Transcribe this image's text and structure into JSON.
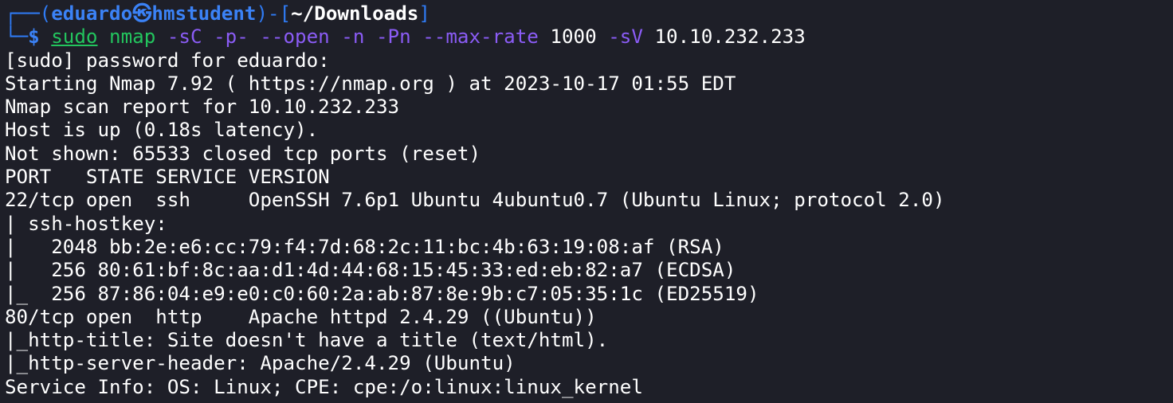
{
  "prompt": {
    "corner_top": "┌──(",
    "user": "eduardo",
    "at_symbol": "㉿",
    "host": "hmstudent",
    "sep": ")-[",
    "cwd": "~/Downloads",
    "close": "]",
    "corner_bottom": "└─",
    "dollar": "$ "
  },
  "command": {
    "sudo": "sudo",
    "nmap": " nmap",
    "opt1": " -sC -p- --open -n -Pn --max-rate",
    "rate": " 1000",
    "opt2": " -sV",
    "target": " 10.10.232.233"
  },
  "output": [
    "[sudo] password for eduardo:",
    "Starting Nmap 7.92 ( https://nmap.org ) at 2023-10-17 01:55 EDT",
    "Nmap scan report for 10.10.232.233",
    "Host is up (0.18s latency).",
    "Not shown: 65533 closed tcp ports (reset)",
    "PORT   STATE SERVICE VERSION",
    "22/tcp open  ssh     OpenSSH 7.6p1 Ubuntu 4ubuntu0.7 (Ubuntu Linux; protocol 2.0)",
    "| ssh-hostkey:",
    "|   2048 bb:2e:e6:cc:79:f4:7d:68:2c:11:bc:4b:63:19:08:af (RSA)",
    "|   256 80:61:bf:8c:aa:d1:4d:44:68:15:45:33:ed:eb:82:a7 (ECDSA)",
    "|_  256 87:86:04:e9:e0:c0:60:2a:ab:87:8e:9b:c7:05:35:1c (ED25519)",
    "80/tcp open  http    Apache httpd 2.4.29 ((Ubuntu))",
    "|_http-title: Site doesn't have a title (text/html).",
    "|_http-server-header: Apache/2.4.29 (Ubuntu)",
    "Service Info: OS: Linux; CPE: cpe:/o:linux:linux_kernel"
  ]
}
